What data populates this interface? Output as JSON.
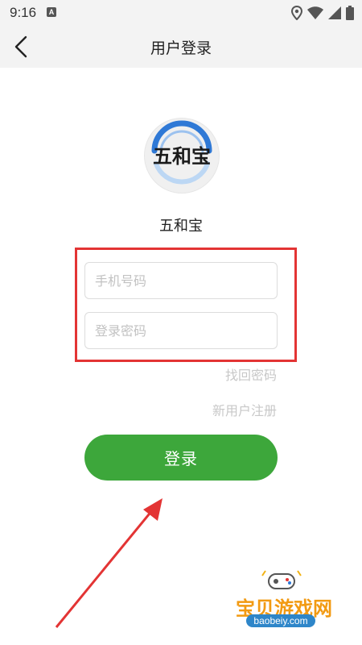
{
  "status_bar": {
    "time": "9:16",
    "notification": "A"
  },
  "header": {
    "title": "用户登录"
  },
  "app": {
    "name": "五和宝",
    "logo_text": "五和宝"
  },
  "form": {
    "phone_placeholder": "手机号码",
    "password_placeholder": "登录密码",
    "forgot_link": "找回密码",
    "register_link": "新用户注册",
    "login_button": "登录"
  },
  "watermark": {
    "name": "宝贝游戏网",
    "url": "baobeiy.com"
  },
  "colors": {
    "accent_green": "#3da73b",
    "highlight_red": "#e33434",
    "logo_blue": "#2f79d6"
  }
}
